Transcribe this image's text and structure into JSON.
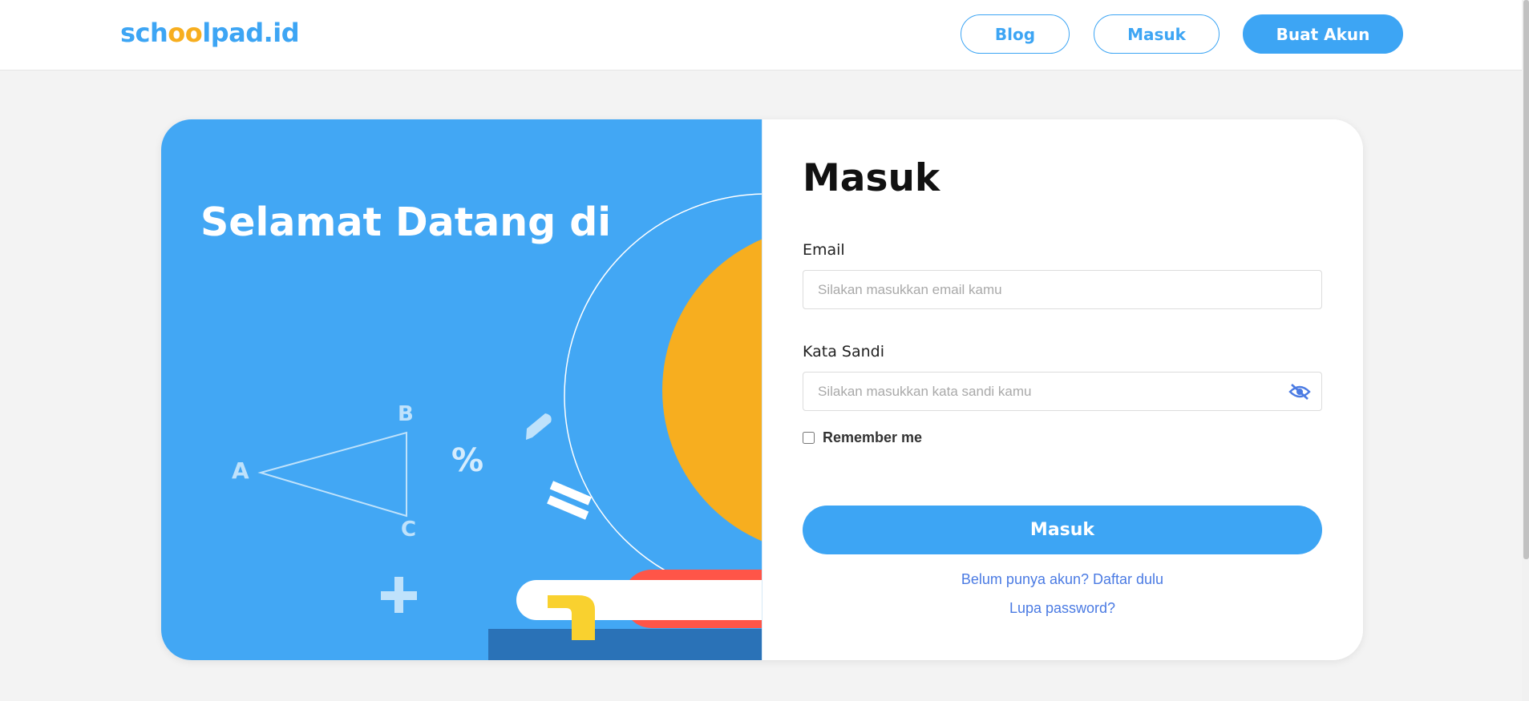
{
  "header": {
    "logo": {
      "part1": "sch",
      "part2": "oo",
      "part3": "lpad.id"
    },
    "nav": {
      "blog": "Blog",
      "login": "Masuk",
      "signup": "Buat Akun"
    }
  },
  "hero": {
    "title": "Selamat Datang di",
    "triangle_labels": {
      "a": "A",
      "b": "B",
      "c": "C"
    },
    "percent_symbol": "%",
    "plus_symbol": "+",
    "equals_symbol": "="
  },
  "form": {
    "title": "Masuk",
    "email": {
      "label": "Email",
      "placeholder": "Silakan masukkan email kamu",
      "value": ""
    },
    "password": {
      "label": "Kata Sandi",
      "placeholder": "Silakan masukkan kata sandi kamu",
      "value": "",
      "toggle_icon": "eye-slash-icon"
    },
    "remember": {
      "label": "Remember me",
      "checked": false
    },
    "submit": "Masuk",
    "register_link": "Belum punya akun? Daftar dulu",
    "forgot_link": "Lupa password?"
  },
  "colors": {
    "brand_blue": "#3da5f4",
    "brand_orange": "#f7ae1f",
    "book_red": "#ff5548",
    "book_dark": "#2a72b7",
    "link_blue": "#4b7be3"
  }
}
